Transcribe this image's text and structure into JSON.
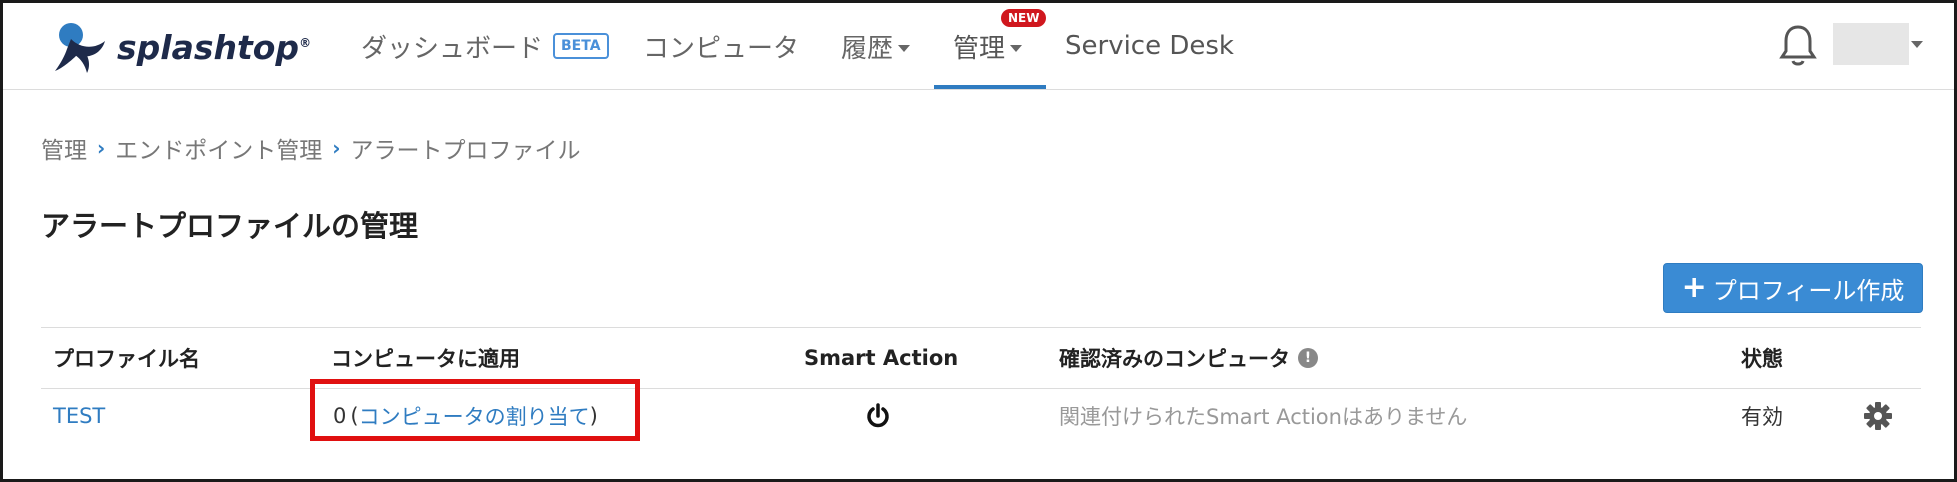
{
  "header": {
    "logo_text": "splashtop",
    "logo_reg": "®",
    "nav": {
      "dashboard": "ダッシュボード",
      "beta": "BETA",
      "computers": "コンピュータ",
      "history": "履歴",
      "manage": "管理",
      "new_badge": "NEW",
      "service_desk": "Service Desk"
    }
  },
  "breadcrumb": [
    "管理",
    "エンドポイント管理",
    "アラートプロファイル"
  ],
  "page_title": "アラートプロファイルの管理",
  "create_button": "プロフィール作成",
  "table": {
    "headers": {
      "name": "プロファイル名",
      "apply": "コンピュータに適用",
      "smart_action": "Smart Action",
      "confirmed": "確認済みのコンピュータ",
      "status": "状態"
    },
    "row": {
      "name": "TEST",
      "count": "0",
      "assign_link": "コンピュータの割り当て",
      "confirmed": "関連付けられたSmart Actionはありません",
      "status": "有効"
    }
  },
  "colors": {
    "accent": "#2f7cc1",
    "button": "#3a8bd4",
    "new_badge": "#d0171e",
    "highlight": "#e01010"
  }
}
